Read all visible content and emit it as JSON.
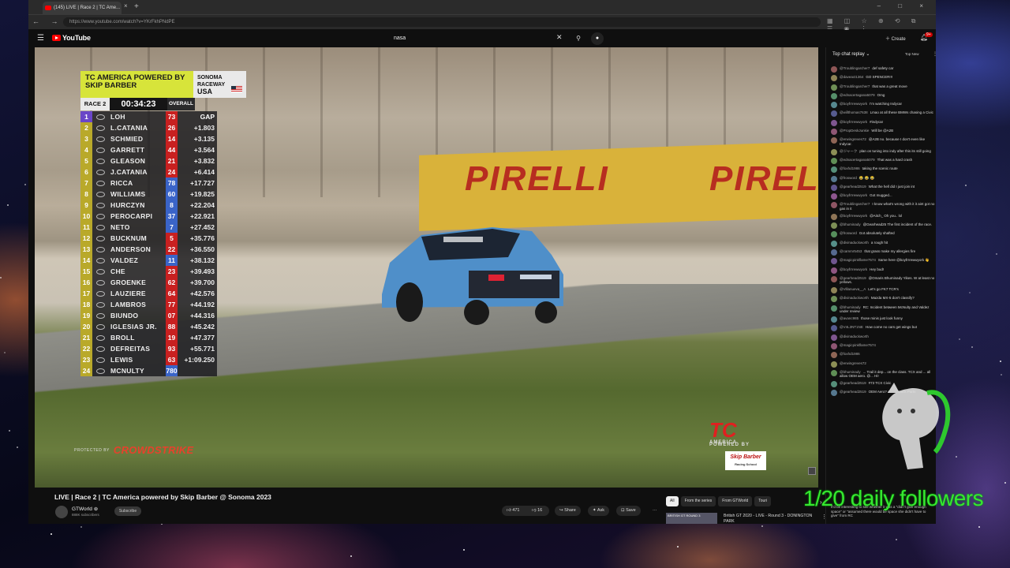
{
  "browser": {
    "tab_title": "(145) LIVE | Race 2 | TC Ame...",
    "tab_close": "×",
    "new_tab": "+",
    "url": "https://www.youtube.com/watch?v=YKrFkhPNdPE",
    "window_buttons": "– □ ×",
    "nav_buttons": "← → ⟳"
  },
  "youtube": {
    "logo_text": "YouTube",
    "search_value": "nasa",
    "create_label": "Create",
    "notification_count": "9+"
  },
  "scoreboard": {
    "series": "TC AMERICA POWERED BY SKIP BARBER",
    "track": "SONOMA RACEWAY",
    "country": "USA",
    "race": "RACE 2",
    "clock": "00:34:23",
    "mode": "OVERALL",
    "gap_header": "GAP",
    "rows": [
      {
        "pos": "1",
        "name": "LOH",
        "num": "73",
        "gap": "GAP",
        "color": "#c82020"
      },
      {
        "pos": "2",
        "name": "L.CATANIA",
        "num": "26",
        "gap": "+1.803",
        "color": "#c82020"
      },
      {
        "pos": "3",
        "name": "SCHMIED",
        "num": "14",
        "gap": "+3.135",
        "color": "#c82020"
      },
      {
        "pos": "4",
        "name": "GARRETT",
        "num": "44",
        "gap": "+3.564",
        "color": "#c82020"
      },
      {
        "pos": "5",
        "name": "GLEASON",
        "num": "21",
        "gap": "+3.832",
        "color": "#c82020"
      },
      {
        "pos": "6",
        "name": "J.CATANIA",
        "num": "24",
        "gap": "+6.414",
        "color": "#c82020"
      },
      {
        "pos": "7",
        "name": "RICCA",
        "num": "78",
        "gap": "+17.727",
        "color": "#3a64c8"
      },
      {
        "pos": "8",
        "name": "WILLIAMS",
        "num": "60",
        "gap": "+19.825",
        "color": "#3a64c8"
      },
      {
        "pos": "9",
        "name": "HURCZYN",
        "num": "8",
        "gap": "+22.204",
        "color": "#3a64c8"
      },
      {
        "pos": "10",
        "name": "PEROCARPI",
        "num": "37",
        "gap": "+22.921",
        "color": "#3a64c8"
      },
      {
        "pos": "11",
        "name": "NETO",
        "num": "7",
        "gap": "+27.452",
        "color": "#3a64c8"
      },
      {
        "pos": "12",
        "name": "BUCKNUM",
        "num": "5",
        "gap": "+35.776",
        "color": "#c82020"
      },
      {
        "pos": "13",
        "name": "ANDERSON",
        "num": "22",
        "gap": "+36.550",
        "color": "#c82020"
      },
      {
        "pos": "14",
        "name": "VALDEZ",
        "num": "11",
        "gap": "+38.132",
        "color": "#3a64c8"
      },
      {
        "pos": "15",
        "name": "CHE",
        "num": "23",
        "gap": "+39.493",
        "color": "#c82020"
      },
      {
        "pos": "16",
        "name": "GROENKE",
        "num": "62",
        "gap": "+39.700",
        "color": "#c82020"
      },
      {
        "pos": "17",
        "name": "LAUZIERE",
        "num": "64",
        "gap": "+42.576",
        "color": "#c82020"
      },
      {
        "pos": "18",
        "name": "LAMBROS",
        "num": "77",
        "gap": "+44.192",
        "color": "#c82020"
      },
      {
        "pos": "19",
        "name": "BIUNDO",
        "num": "07",
        "gap": "+44.316",
        "color": "#c82020"
      },
      {
        "pos": "20",
        "name": "IGLESIAS JR.",
        "num": "88",
        "gap": "+45.242",
        "color": "#c82020"
      },
      {
        "pos": "21",
        "name": "BROLL",
        "num": "19",
        "gap": "+47.377",
        "color": "#c82020"
      },
      {
        "pos": "22",
        "name": "DEFREITAS",
        "num": "93",
        "gap": "+55.771",
        "color": "#c82020"
      },
      {
        "pos": "23",
        "name": "LEWIS",
        "num": "63",
        "gap": "+1:09.250",
        "color": "#c82020"
      },
      {
        "pos": "24",
        "name": "MCNULTY",
        "num": "780",
        "gap": "",
        "color": "#3a64c8"
      }
    ],
    "protected_by": "PROTECTED BY",
    "sponsor": "CROWDSTRIKE"
  },
  "video_brand": {
    "tc": "TC",
    "america": "AMERICA",
    "powered": "POWERED BY",
    "skip": "Skip Barber",
    "skip_sub": "Racing School"
  },
  "video": {
    "title": "LIVE | Race 2 | TC America powered by Skip Barber @ Sonoma 2023",
    "channel": "GTWorld ⊛",
    "subscribers": "888K subscribers",
    "subscribe": "Subscribe",
    "likes": "471",
    "dislikes": "16",
    "share": "Share",
    "ask": "Ask",
    "save": "Save",
    "more": "···"
  },
  "chips": [
    "All",
    "From the series",
    "From GTWorld",
    "Touri"
  ],
  "recommendation": {
    "thumb_text": "BRITISH GT ROUND 3",
    "title": "British GT 2020 - LIVE - Round 3 - DONINGTON PARK"
  },
  "chat": {
    "header": "Top chat replay ⌄",
    "top_new": "Top New",
    "messages": [
      {
        "author": "@Troublingarcher7",
        "text": "def safety car"
      },
      {
        "author": "@daveact1364",
        "text": "GO SPENCER!!!"
      },
      {
        "author": "@Troublingarcher7",
        "text": "that was a great move"
      },
      {
        "author": "@ednacertagana5079",
        "text": "Omg"
      },
      {
        "author": "@boyfrrrewwyork",
        "text": "I'm watching Indycar"
      },
      {
        "author": "@willthomas7638",
        "text": "Lmao at all these BMWs chasing a Civic"
      },
      {
        "author": "@boyfrrrewwyork",
        "text": "#indycar"
      },
      {
        "author": "@PropDeskJunkie",
        "text": "Will be @A2B"
      },
      {
        "author": "@erwingreves72",
        "text": "@A2B no. because I don't even like Indycar."
      },
      {
        "author": "@ジャーク",
        "text": "plan on tuning into indy after this its still going"
      },
      {
        "author": "@ednacertagana5079",
        "text": "That was a hard crash"
      },
      {
        "author": "@foxhd1986",
        "text": "taking the scenic route"
      },
      {
        "author": "@frosword",
        "text": "😂 😂 😂"
      },
      {
        "author": "@gearhead2519",
        "text": "What the hell did I just join int"
      },
      {
        "author": "@boyfrrrewwyork",
        "text": "Got mugged..."
      },
      {
        "author": "@Troublingarcher7",
        "text": "I know what's wrong with it it aint got no gas in it"
      },
      {
        "author": "@boyfrrrewwyork",
        "text": "@Aitch_ Oh you.. lol"
      },
      {
        "author": "@bhuminady",
        "text": "@Gearhead25 The first incident of the race."
      },
      {
        "author": "@frosword",
        "text": "Got absolutely shafted"
      },
      {
        "author": "@divinaduckworth",
        "text": "a rough hit"
      },
      {
        "author": "@cammr5453",
        "text": "that grass make my allergies fire"
      },
      {
        "author": "@magicpinkflame7574",
        "text": "Same here @boyfrrrewwyork 👋"
      },
      {
        "author": "@boyfrrrewwyork",
        "text": "Hey bud!"
      },
      {
        "author": "@gearhead2519",
        "text": "@Omaris Bhuminady Yikes. W at least no yellows."
      },
      {
        "author": "@Villanueva__A",
        "text": "Let's go FK7 TCR's"
      },
      {
        "author": "@divinaduckworth",
        "text": "Mazda MX-5 don't classify?"
      },
      {
        "author": "@bhuminady",
        "text": "RC: Incident between McNulty and Valdez under review"
      },
      {
        "author": "@avanc985",
        "text": "those minis just look funny"
      },
      {
        "author": "@V4L3NT1NE",
        "text": "How come no cars get wings but"
      },
      {
        "author": "@divinaduckworth",
        "text": ""
      },
      {
        "author": "@magicpinkflame7574",
        "text": ""
      },
      {
        "author": "@foxhd1986",
        "text": ""
      },
      {
        "author": "@erwingreves72",
        "text": ""
      },
      {
        "author": "@bhuminady",
        "text": "... Trail it dep... on the class. TCX and ... all allow OEM aero. @... Hi!"
      },
      {
        "author": "@gearhead2519",
        "text": "#73 TCX Civic"
      },
      {
        "author": "@gearhead2519",
        "text": "OEM Aero? As in. Stock Parts"
      }
    ],
    "bottom_text": "It'd be interesting to see whether it was a \"didn't give enough space\" or \"assumed there would be space she didn't have to give\" from RC"
  },
  "overlay": {
    "followers": "1/20 daily followers"
  }
}
